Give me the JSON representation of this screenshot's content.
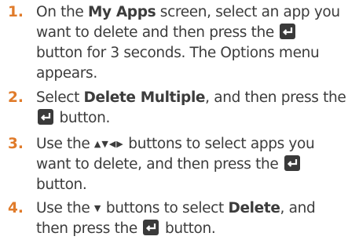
{
  "colors": {
    "step_number": "#e07b2a",
    "text": "#3c3c3c",
    "icon_bg": "#3a3a3a",
    "icon_fg": "#ffffff"
  },
  "icons": {
    "enter": "enter-button-icon",
    "up": "up-arrow-icon",
    "down": "down-arrow-icon",
    "left": "left-arrow-icon",
    "right": "right-arrow-icon"
  },
  "steps": [
    {
      "number": "1.",
      "t1": "On the ",
      "b1": "My Apps",
      "t2": " screen, select an app you want to delete and then press the ",
      "t3": " button for 3 seconds. The Options menu appears."
    },
    {
      "number": "2.",
      "t1": "Select ",
      "b1": "Delete Multiple",
      "t2": ", and then press the ",
      "t3": " button."
    },
    {
      "number": "3.",
      "t1": "Use the ",
      "t2": " buttons to select apps you want to delete, and then press the ",
      "t3": " button."
    },
    {
      "number": "4.",
      "t1": "Use the ",
      "t2": " buttons to select ",
      "b1": "Delete",
      "t3": ", and then press the ",
      "t4": " button."
    }
  ]
}
